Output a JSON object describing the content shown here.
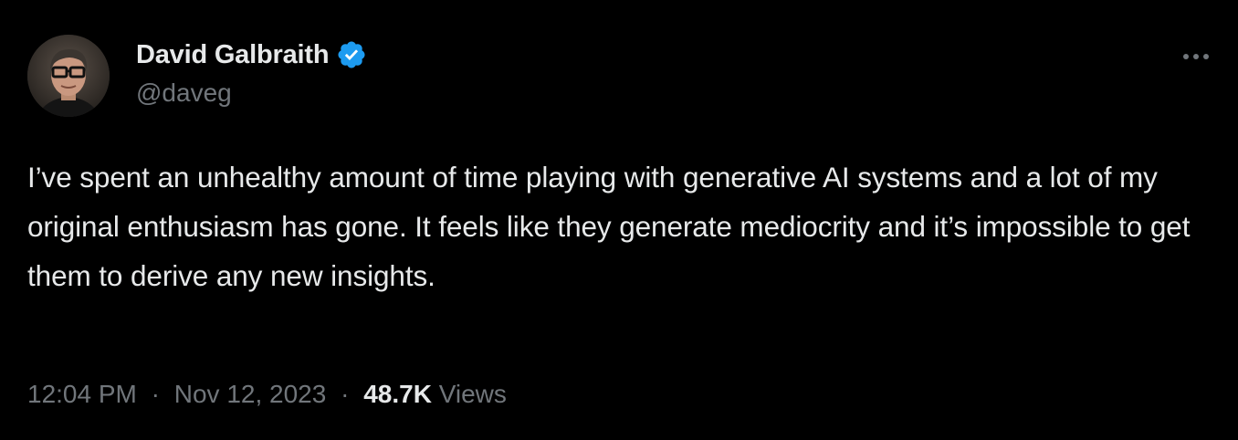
{
  "author": {
    "display_name": "David Galbraith",
    "handle": "@daveg",
    "verified": true,
    "avatar_icon": "profile-photo"
  },
  "tweet": {
    "text": "I’ve spent an unhealthy amount of time playing with generative AI systems and a lot of my original enthusiasm has gone. It feels like they generate mediocrity and it’s impossible to get them to derive any new insights."
  },
  "meta": {
    "time": "12:04 PM",
    "separator": "·",
    "date": "Nov 12, 2023",
    "views_count": "48.7K",
    "views_label": "Views"
  },
  "colors": {
    "background": "#000000",
    "text_primary": "#e7e9ea",
    "text_secondary": "#71767b",
    "verified_badge": "#1d9bf0"
  },
  "icons": {
    "verified": "verified-badge-icon",
    "more": "more-horizontal-icon"
  }
}
